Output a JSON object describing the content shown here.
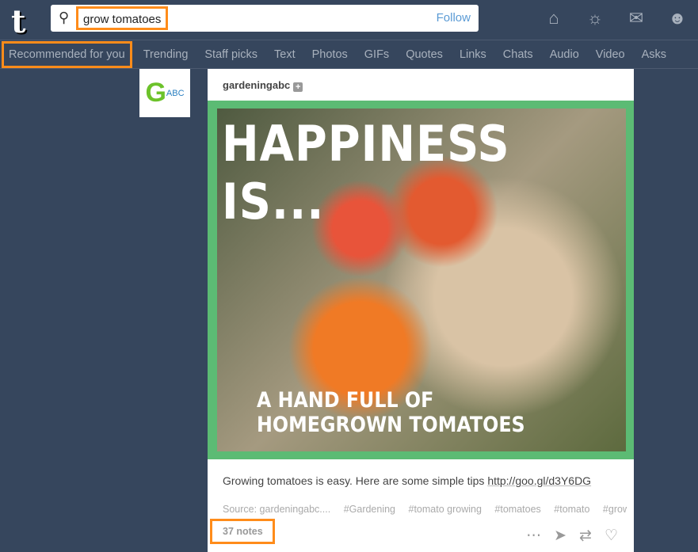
{
  "header": {
    "logo": "t",
    "search_value": "grow tomatoes",
    "follow_label": "Follow",
    "icons": [
      "home-icon",
      "compass-icon",
      "mail-icon",
      "account-icon"
    ]
  },
  "nav": {
    "items": [
      "Recommended for you",
      "Trending",
      "Staff picks",
      "Text",
      "Photos",
      "GIFs",
      "Quotes",
      "Links",
      "Chats",
      "Audio",
      "Video",
      "Asks"
    ]
  },
  "post": {
    "blog": "gardeningabc",
    "avatar_text": "ABC",
    "image_title": "HAPPINESS IS...",
    "image_subtitle": "A HAND FULL OF HOMEGROWN TOMATOES",
    "caption": "Growing tomatoes is easy. Here are some simple tips ",
    "link": "http://goo.gl/d3Y6DG",
    "source": "Source: gardeningabc....",
    "tags": [
      "#Gardening",
      "#tomato growing",
      "#tomatoes",
      "#tomato",
      "#grow"
    ],
    "notes": "37 notes",
    "accent": "#5cbb74"
  }
}
